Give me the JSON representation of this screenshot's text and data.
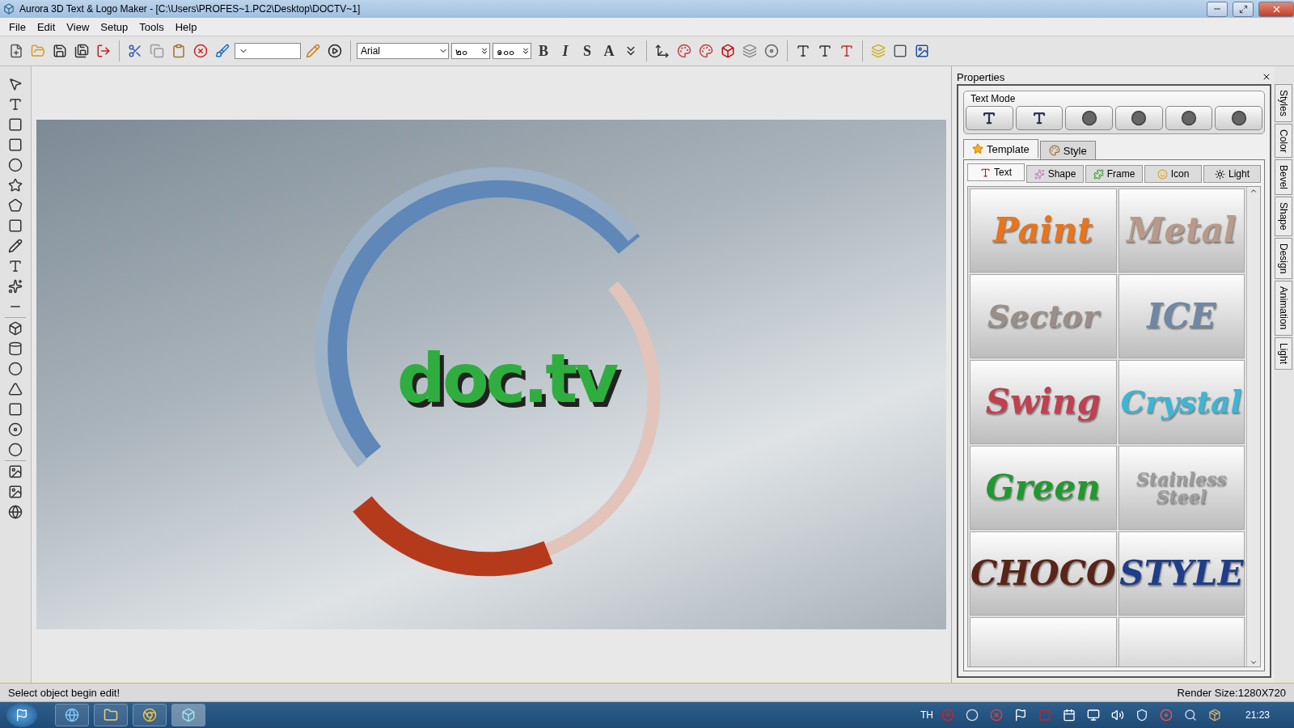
{
  "window": {
    "title": "Aurora 3D Text & Logo Maker - [C:\\Users\\PROFES~1.PC2\\Desktop\\DOCTV~1]"
  },
  "menu": [
    "File",
    "Edit",
    "View",
    "Setup",
    "Tools",
    "Help"
  ],
  "toolbar": {
    "font": "Arial",
    "size": "๒๐",
    "scale": "๑๐๐",
    "format_buttons": [
      "B",
      "I",
      "S",
      "A"
    ]
  },
  "canvas": {
    "logo_text": "doc.tv"
  },
  "properties": {
    "title": "Properties",
    "text_mode_label": "Text Mode",
    "tabs": [
      {
        "label": "Template",
        "selected": true
      },
      {
        "label": "Style",
        "selected": false
      }
    ],
    "sub_tabs": [
      {
        "label": "Text",
        "selected": true
      },
      {
        "label": "Shape",
        "selected": false
      },
      {
        "label": "Frame",
        "selected": false
      },
      {
        "label": "Icon",
        "selected": false
      },
      {
        "label": "Light",
        "selected": false
      }
    ],
    "templates": [
      {
        "label": "Paint",
        "color": "#e8741c"
      },
      {
        "label": "Metal",
        "color": "#b89a8a"
      },
      {
        "label": "Sector",
        "color": "#9a8f88"
      },
      {
        "label": "ICE",
        "color": "#6f88a3"
      },
      {
        "label": "Swing",
        "color": "#c04050"
      },
      {
        "label": "Crystal",
        "color": "#3bb6d6"
      },
      {
        "label": "Green",
        "color": "#1f9a2e"
      },
      {
        "label": "Stainless Steel",
        "color": "#9c9c9c"
      },
      {
        "label": "CHOCO",
        "color": "#5a2418"
      },
      {
        "label": "STYLE",
        "color": "#1f3e8a"
      }
    ],
    "side_tabs": [
      "Styles",
      "Color",
      "Bevel",
      "Shape",
      "Design",
      "Animation",
      "Light"
    ]
  },
  "status_bar": {
    "message": "Select object begin edit!",
    "render_size": "Render Size:1280X720"
  },
  "taskbar": {
    "language": "TH",
    "clock": "21:23"
  }
}
